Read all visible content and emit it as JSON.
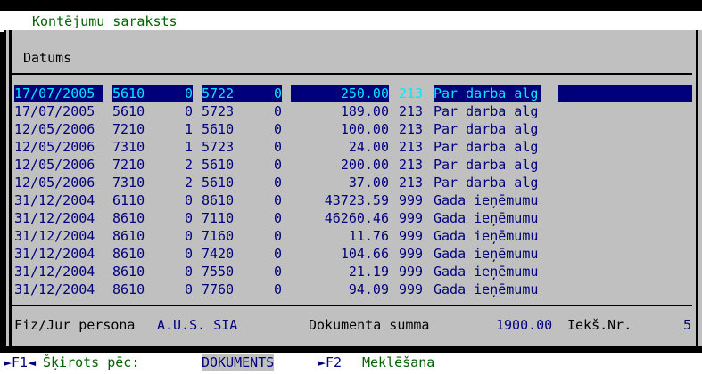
{
  "window": {
    "title": "Kontējumu saraksts"
  },
  "list": {
    "header": "Datums",
    "rows": [
      {
        "date": "17/07/2005",
        "acc1": "5610",
        "n1": "0",
        "acc2": "5722",
        "n2": "0",
        "amount": "250.00",
        "code": "213",
        "desc": "Par darba alg",
        "selected": true
      },
      {
        "date": "17/07/2005",
        "acc1": "5610",
        "n1": "0",
        "acc2": "5723",
        "n2": "0",
        "amount": "189.00",
        "code": "213",
        "desc": "Par darba alg"
      },
      {
        "date": "12/05/2006",
        "acc1": "7210",
        "n1": "1",
        "acc2": "5610",
        "n2": "0",
        "amount": "100.00",
        "code": "213",
        "desc": "Par darba alg"
      },
      {
        "date": "12/05/2006",
        "acc1": "7310",
        "n1": "1",
        "acc2": "5723",
        "n2": "0",
        "amount": "24.00",
        "code": "213",
        "desc": "Par darba alg"
      },
      {
        "date": "12/05/2006",
        "acc1": "7210",
        "n1": "2",
        "acc2": "5610",
        "n2": "0",
        "amount": "200.00",
        "code": "213",
        "desc": "Par darba alg"
      },
      {
        "date": "12/05/2006",
        "acc1": "7310",
        "n1": "2",
        "acc2": "5610",
        "n2": "0",
        "amount": "37.00",
        "code": "213",
        "desc": "Par darba alg"
      },
      {
        "date": "31/12/2004",
        "acc1": "6110",
        "n1": "0",
        "acc2": "8610",
        "n2": "0",
        "amount": "43723.59",
        "code": "999",
        "desc": "Gada ieņēmumu"
      },
      {
        "date": "31/12/2004",
        "acc1": "8610",
        "n1": "0",
        "acc2": "7110",
        "n2": "0",
        "amount": "46260.46",
        "code": "999",
        "desc": "Gada ieņēmumu"
      },
      {
        "date": "31/12/2004",
        "acc1": "8610",
        "n1": "0",
        "acc2": "7160",
        "n2": "0",
        "amount": "11.76",
        "code": "999",
        "desc": "Gada ieņēmumu"
      },
      {
        "date": "31/12/2004",
        "acc1": "8610",
        "n1": "0",
        "acc2": "7420",
        "n2": "0",
        "amount": "104.66",
        "code": "999",
        "desc": "Gada ieņēmumu"
      },
      {
        "date": "31/12/2004",
        "acc1": "8610",
        "n1": "0",
        "acc2": "7550",
        "n2": "0",
        "amount": "21.19",
        "code": "999",
        "desc": "Gada ieņēmumu"
      },
      {
        "date": "31/12/2004",
        "acc1": "8610",
        "n1": "0",
        "acc2": "7760",
        "n2": "0",
        "amount": "94.09",
        "code": "999",
        "desc": "Gada ieņēmumu"
      }
    ]
  },
  "footer": {
    "person_label": "Fiz/Jur persona",
    "person_value": "A.U.S. SIA",
    "sum_label": "Dokumenta summa",
    "sum_value": "1900.00",
    "num_label": "Iekš.Nr.",
    "num_value": "5"
  },
  "fkeys": {
    "f1_key": "►F1◄",
    "f1_label": "Šķirots pēc:",
    "f1_value": "DOKUMENTS",
    "f2_key": "►F2",
    "f2_label": "Meklēšana"
  },
  "colors": {
    "panel": "#c0c0c0",
    "text": "#00007b",
    "selection_bg": "#00007b",
    "selection_text": "#00e8ff",
    "title_text": "#006400"
  }
}
